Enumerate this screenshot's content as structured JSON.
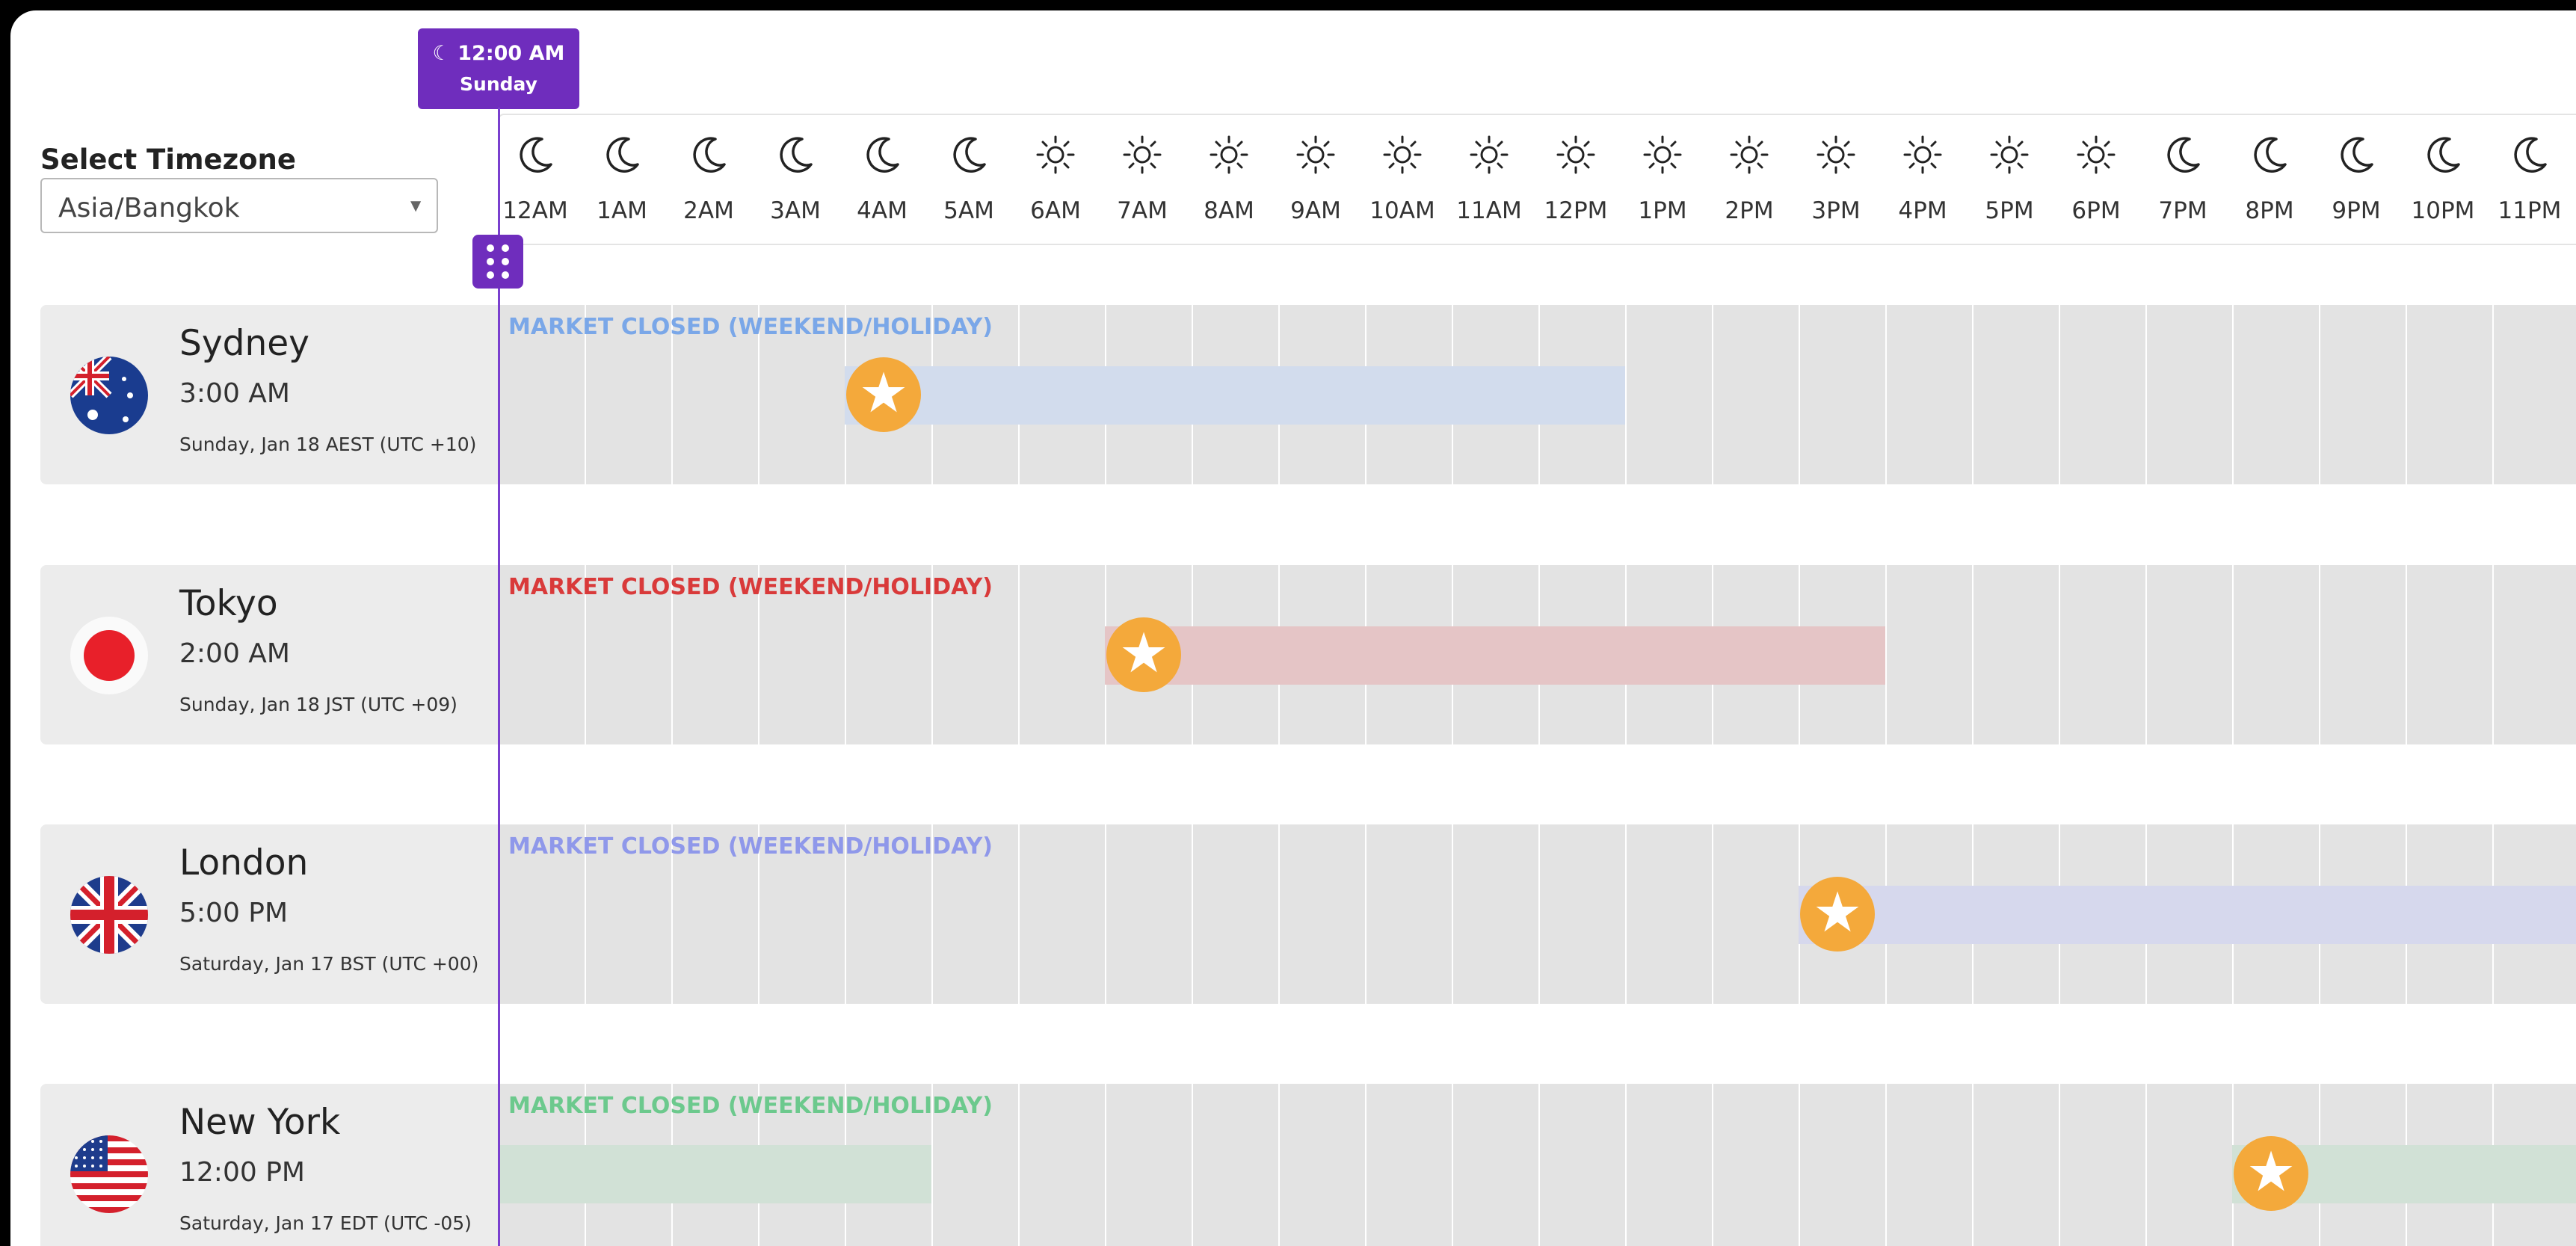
{
  "current_time": {
    "time": "12:00 AM",
    "day": "Sunday",
    "icon": "moon-icon"
  },
  "timezone_select": {
    "label": "Select Timezone",
    "value": "Asia/Bangkok"
  },
  "hours": [
    {
      "label": "12AM",
      "icon": "moon-icon"
    },
    {
      "label": "1AM",
      "icon": "moon-icon"
    },
    {
      "label": "2AM",
      "icon": "moon-icon"
    },
    {
      "label": "3AM",
      "icon": "moon-icon"
    },
    {
      "label": "4AM",
      "icon": "moon-icon"
    },
    {
      "label": "5AM",
      "icon": "moon-icon"
    },
    {
      "label": "6AM",
      "icon": "sun-icon"
    },
    {
      "label": "7AM",
      "icon": "sun-icon"
    },
    {
      "label": "8AM",
      "icon": "sun-icon"
    },
    {
      "label": "9AM",
      "icon": "sun-icon"
    },
    {
      "label": "10AM",
      "icon": "sun-icon"
    },
    {
      "label": "11AM",
      "icon": "sun-icon"
    },
    {
      "label": "12PM",
      "icon": "sun-icon"
    },
    {
      "label": "1PM",
      "icon": "sun-icon"
    },
    {
      "label": "2PM",
      "icon": "sun-icon"
    },
    {
      "label": "3PM",
      "icon": "sun-icon"
    },
    {
      "label": "4PM",
      "icon": "sun-icon"
    },
    {
      "label": "5PM",
      "icon": "sun-icon"
    },
    {
      "label": "6PM",
      "icon": "sun-icon"
    },
    {
      "label": "7PM",
      "icon": "moon-icon"
    },
    {
      "label": "8PM",
      "icon": "moon-icon"
    },
    {
      "label": "9PM",
      "icon": "moon-icon"
    },
    {
      "label": "10PM",
      "icon": "moon-icon"
    },
    {
      "label": "11PM",
      "icon": "moon-icon"
    }
  ],
  "cities": [
    {
      "name": "Sydney",
      "time": "3:00 AM",
      "date": "Sunday, Jan 18 AEST (UTC +10)",
      "status": "MARKET CLOSED (WEEKEND/HOLIDAY)",
      "status_color": "#7aa7e8",
      "session_color": "#d2dced",
      "session_start_hour": 4,
      "session_end_hour": 13,
      "flag": "australia-flag"
    },
    {
      "name": "Tokyo",
      "time": "2:00 AM",
      "date": "Sunday, Jan 18 JST (UTC +09)",
      "status": "MARKET CLOSED (WEEKEND/HOLIDAY)",
      "status_color": "#d93a3a",
      "session_color": "#e5c5c6",
      "session_start_hour": 7,
      "session_end_hour": 16,
      "flag": "japan-flag"
    },
    {
      "name": "London",
      "time": "5:00 PM",
      "date": "Saturday, Jan 17 BST (UTC +00)",
      "status": "MARKET CLOSED (WEEKEND/HOLIDAY)",
      "status_color": "#8f98ea",
      "session_color": "#d6d8ed",
      "session_start_hour": 15,
      "session_end_hour": 24,
      "flag": "uk-flag"
    },
    {
      "name": "New York",
      "time": "12:00 PM",
      "date": "Saturday, Jan 17 EDT (UTC -05)",
      "status": "MARKET CLOSED (WEEKEND/HOLIDAY)",
      "status_color": "#6cc98d",
      "session_color": "#d1e1d6",
      "session_start_hour": 0,
      "session_end_hour": 5,
      "session2_start_hour": 20,
      "session2_end_hour": 24,
      "star_hour": 20,
      "flag": "usa-flag"
    }
  ]
}
